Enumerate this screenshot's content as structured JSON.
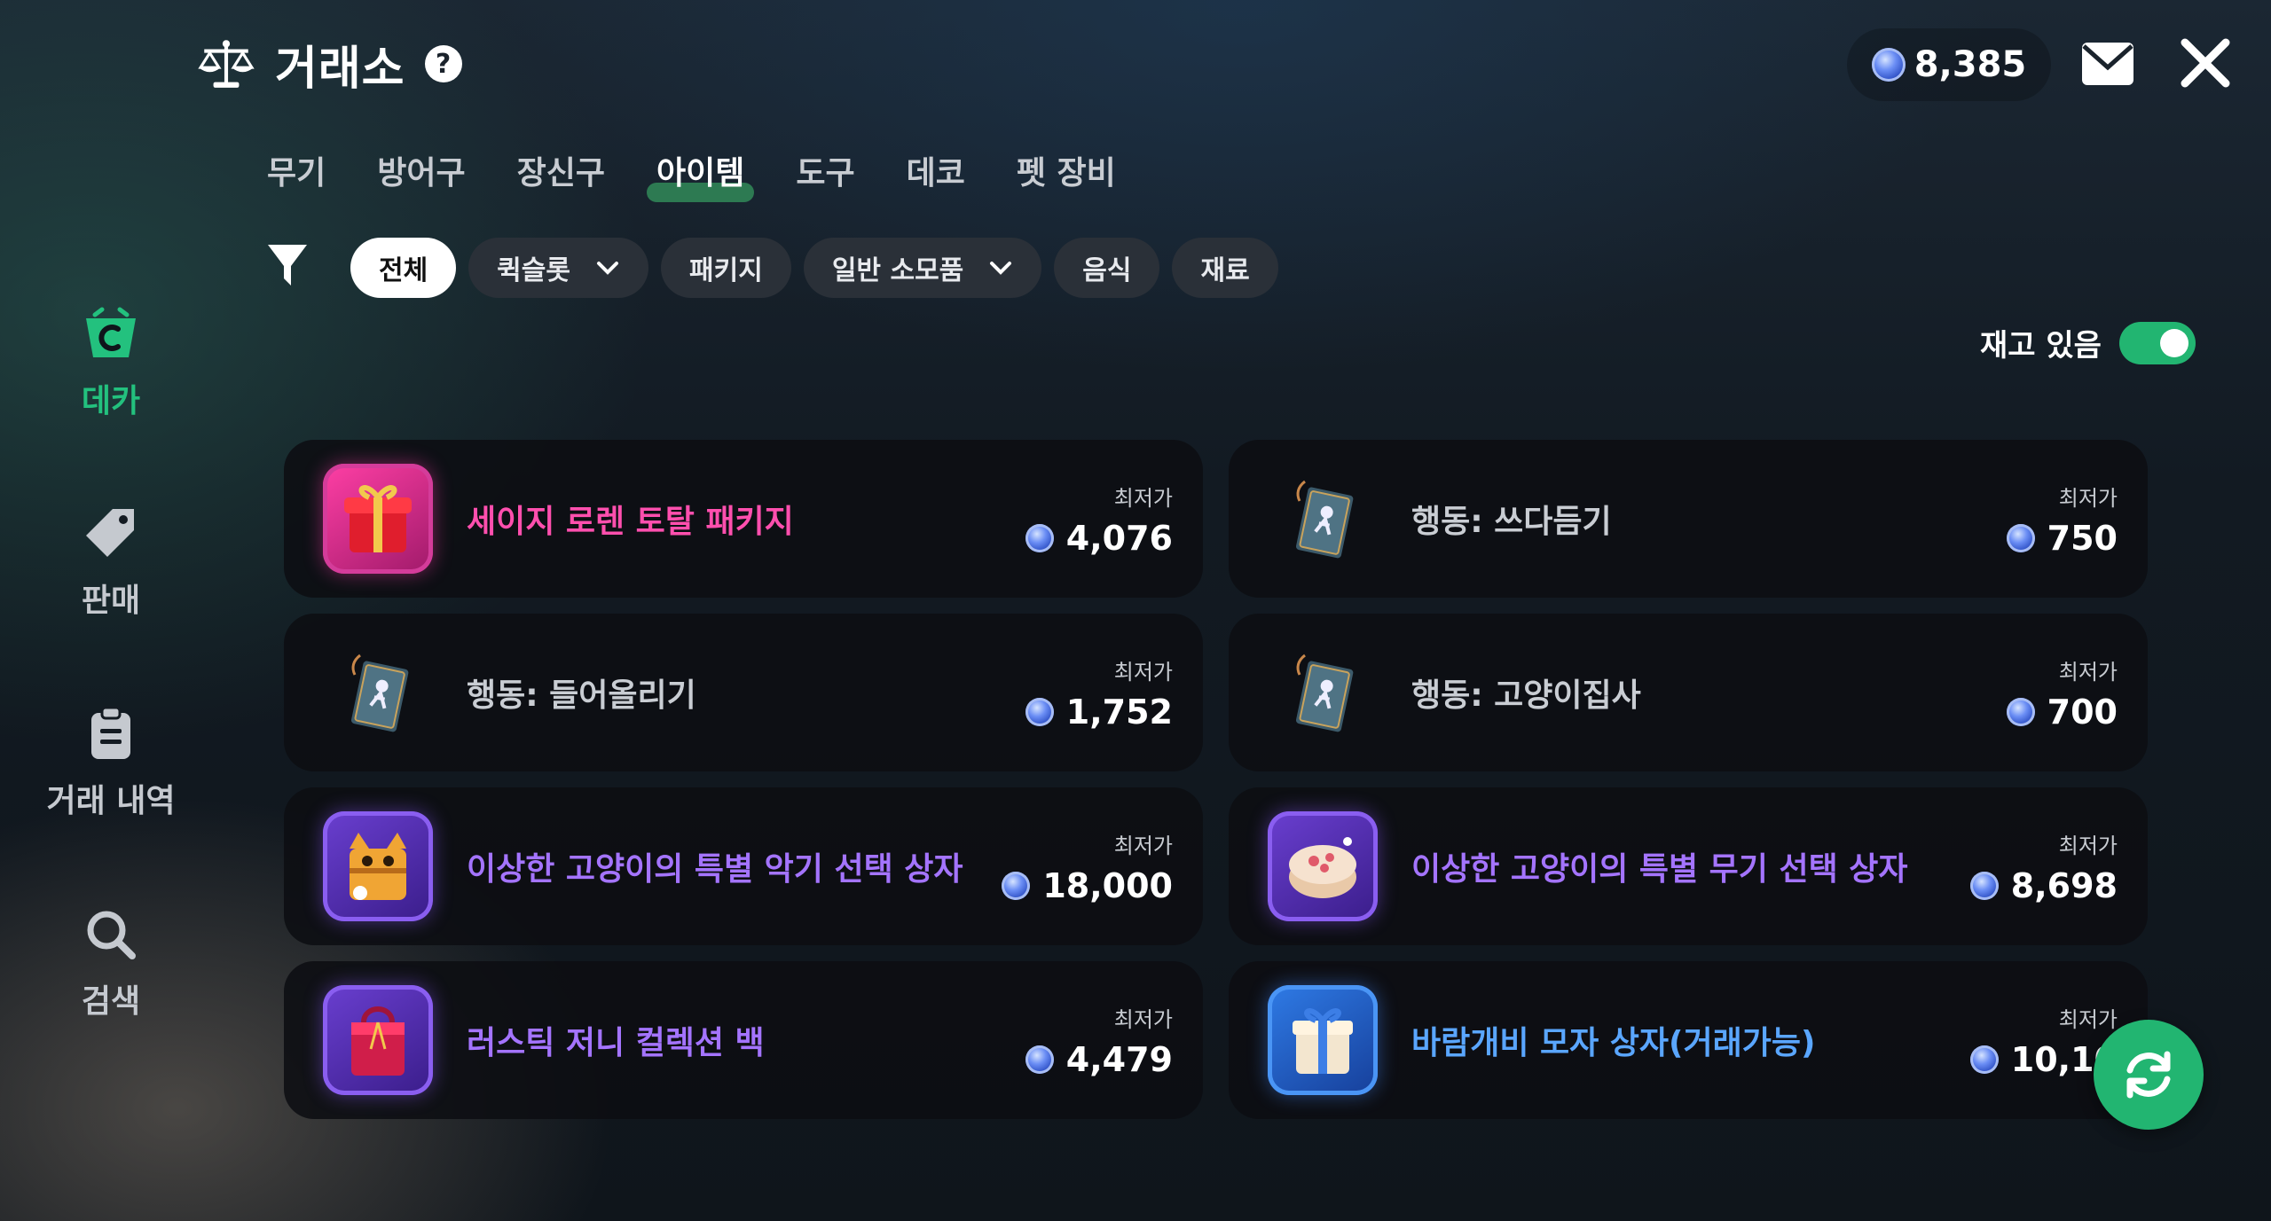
{
  "header": {
    "title": "거래소",
    "help_icon": "?",
    "currency": "8,385"
  },
  "tabs": [
    {
      "label": "무기",
      "active": false
    },
    {
      "label": "방어구",
      "active": false
    },
    {
      "label": "장신구",
      "active": false
    },
    {
      "label": "아이템",
      "active": true
    },
    {
      "label": "도구",
      "active": false
    },
    {
      "label": "데코",
      "active": false
    },
    {
      "label": "펫 장비",
      "active": false
    }
  ],
  "filters": [
    {
      "label": "전체",
      "active": true,
      "dropdown": false
    },
    {
      "label": "퀵슬롯",
      "active": false,
      "dropdown": true
    },
    {
      "label": "패키지",
      "active": false,
      "dropdown": false
    },
    {
      "label": "일반 소모품",
      "active": false,
      "dropdown": true
    },
    {
      "label": "음식",
      "active": false,
      "dropdown": false
    },
    {
      "label": "재료",
      "active": false,
      "dropdown": false
    }
  ],
  "stock_toggle": {
    "label": "재고 있음",
    "on": true
  },
  "sidebar": [
    {
      "label": "데카",
      "icon": "basket-icon",
      "active": true
    },
    {
      "label": "판매",
      "icon": "tag-icon",
      "active": false
    },
    {
      "label": "거래 내역",
      "icon": "clipboard-icon",
      "active": false
    },
    {
      "label": "검색",
      "icon": "search-icon",
      "active": false
    }
  ],
  "price_label": "최저가",
  "items": [
    {
      "name": "세이지 로렌 토탈 패키지",
      "price": "4,076",
      "rarity": "pink",
      "icon": "gift-box-icon"
    },
    {
      "name": "행동: 쓰다듬기",
      "price": "750",
      "rarity": "gray",
      "icon": "action-book-icon"
    },
    {
      "name": "행동: 들어올리기",
      "price": "1,752",
      "rarity": "gray",
      "icon": "action-book-icon"
    },
    {
      "name": "행동: 고양이집사",
      "price": "700",
      "rarity": "gray",
      "icon": "action-book-icon"
    },
    {
      "name": "이상한 고양이의 특별 악기 선택 상자",
      "price": "18,000",
      "rarity": "purple",
      "icon": "cat-box-icon"
    },
    {
      "name": "이상한 고양이의 특별 무기 선택 상자",
      "price": "8,698",
      "rarity": "purple",
      "icon": "cake-box-icon"
    },
    {
      "name": "러스틱 저니 컬렉션 백",
      "price": "4,479",
      "rarity": "purple",
      "icon": "bag-icon"
    },
    {
      "name": "바람개비 모자 상자(거래가능)",
      "price": "10,10",
      "rarity": "blue",
      "icon": "hat-box-icon"
    }
  ],
  "colors": {
    "accent": "#22b571",
    "pink": "#ff4fae",
    "purple": "#a474ff",
    "blue": "#5aa6ff"
  }
}
